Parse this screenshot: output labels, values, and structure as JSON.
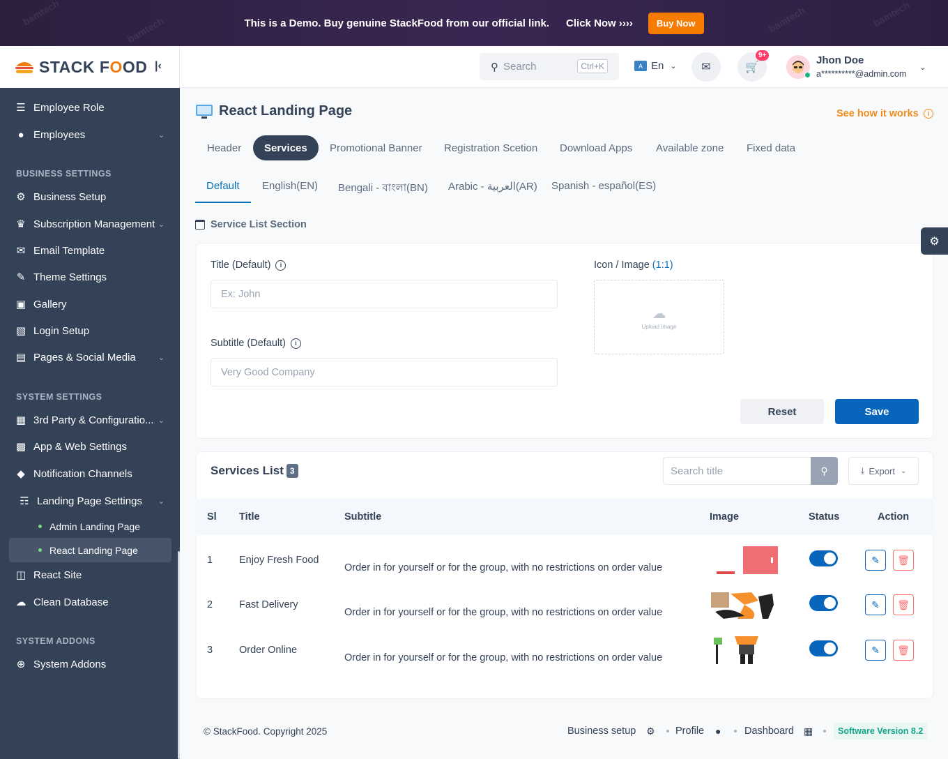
{
  "banner": {
    "text": "This is a Demo. Buy genuine StackFood from our official link.",
    "click": "Click Now ››››",
    "button": "Buy Now",
    "watermark": "bamtech"
  },
  "sidebar": {
    "logo_a": "STACK F",
    "logo_o": "O",
    "logo_b": "OD",
    "items_top": [
      {
        "label": "Employee Role",
        "icon": "role-icon"
      },
      {
        "label": "Employees",
        "icon": "user-icon"
      }
    ],
    "section_business": "BUSINESS SETTINGS",
    "items_business": [
      {
        "label": "Business Setup",
        "icon": "gear-icon"
      },
      {
        "label": "Subscription Management",
        "icon": "crown-icon"
      },
      {
        "label": "Email Template",
        "icon": "mail-icon"
      },
      {
        "label": "Theme Settings",
        "icon": "brush-icon"
      },
      {
        "label": "Gallery",
        "icon": "gallery-icon"
      },
      {
        "label": "Login Setup",
        "icon": "login-icon"
      },
      {
        "label": "Pages & Social Media",
        "icon": "pages-icon"
      }
    ],
    "section_system": "SYSTEM SETTINGS",
    "items_system": [
      {
        "label": "3rd Party & Configuratio...",
        "icon": "config-icon"
      },
      {
        "label": "App & Web Settings",
        "icon": "android-icon"
      },
      {
        "label": "Notification Channels",
        "icon": "bell-icon"
      },
      {
        "label": "Landing Page Settings",
        "icon": "landing-icon"
      }
    ],
    "sub_items": [
      "Admin Landing Page",
      "React Landing Page"
    ],
    "items_after": [
      {
        "label": "React Site",
        "icon": "react-icon"
      },
      {
        "label": "Clean Database",
        "icon": "cloud-icon"
      }
    ],
    "section_addons": "SYSTEM ADDONS",
    "items_addons": [
      {
        "label": "System Addons",
        "icon": "plus-circle-icon"
      }
    ]
  },
  "topbar": {
    "search_placeholder": "Search",
    "search_shortcut": "Ctrl+K",
    "language": "En",
    "cart_badge": "9+",
    "user_name": "Jhon Doe",
    "user_email": "a**********@admin.com"
  },
  "page": {
    "title": "React Landing Page",
    "how_link": "See how it works",
    "tabs": [
      "Header",
      "Services",
      "Promotional Banner",
      "Registration Scetion",
      "Download Apps",
      "Available zone",
      "Fixed data"
    ],
    "lang_tabs": [
      "Default",
      "English(EN)",
      "Bengali - বাংলা(BN)",
      "Arabic - العربية(AR)",
      "Spanish - español(ES)"
    ],
    "section_title": "Service List Section"
  },
  "form": {
    "title_label": "Title (Default)",
    "title_placeholder": "Ex: John",
    "subtitle_label": "Subtitle (Default)",
    "subtitle_value": "Very Good Company",
    "icon_label": "Icon / Image",
    "icon_ratio": "(1:1)",
    "upload_text": "Upload Image",
    "reset": "Reset",
    "save": "Save"
  },
  "list": {
    "title": "Services List",
    "count": "3",
    "search_placeholder": "Search title",
    "export": "Export",
    "columns": [
      "Sl",
      "Title",
      "Subtitle",
      "Image",
      "Status",
      "Action"
    ],
    "rows": [
      {
        "sl": "1",
        "title": "Enjoy Fresh Food",
        "subtitle": "Order in for yourself or for the group, with no restrictions on order value",
        "status": true
      },
      {
        "sl": "2",
        "title": "Fast Delivery",
        "subtitle": "Order in for yourself or for the group, with no restrictions on order value",
        "status": true
      },
      {
        "sl": "3",
        "title": "Order Online",
        "subtitle": "Order in for yourself or for the group, with no restrictions on order value",
        "status": true
      }
    ]
  },
  "footer": {
    "copyright": "© StackFood. Copyright 2025",
    "links": [
      "Business setup",
      "Profile",
      "Dashboard"
    ],
    "version": "Software Version 8.2"
  },
  "colors": {
    "sidebar": "#334257",
    "primary": "#0766bb",
    "accent": "#f28c1e",
    "banner_button": "#f57c00"
  }
}
